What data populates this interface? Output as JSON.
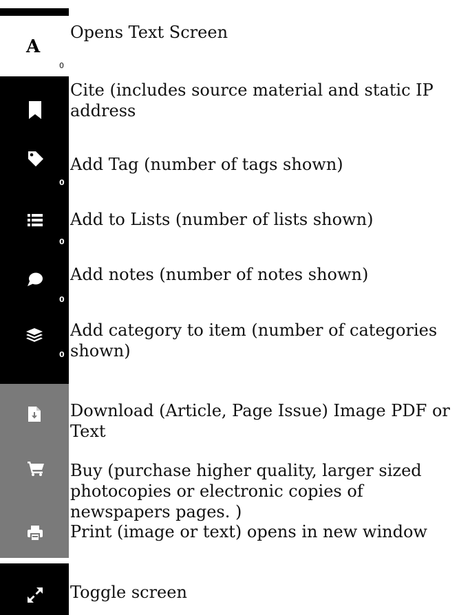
{
  "toolbar": {
    "text_button": {
      "letter": "A",
      "count": "0",
      "label": "Opens Text Screen"
    },
    "cite_button": {
      "label": "Cite (includes source material and static IP address"
    },
    "tag_button": {
      "count": "0",
      "label": "Add Tag (number of tags shown)"
    },
    "lists_button": {
      "count": "0",
      "label": "Add to Lists (number of lists shown)"
    },
    "notes_button": {
      "count": "0",
      "label": "Add notes (number of notes shown)"
    },
    "category_button": {
      "count": "0",
      "label": "Add category to item (number of categories shown)"
    },
    "download_button": {
      "label": "Download (Article, Page Issue) Image PDF or Text"
    },
    "buy_button": {
      "label": "Buy (purchase higher quality, larger sized photocopies or electronic copies of newspapers pages. )"
    },
    "print_button": {
      "label": "Print (image or text) opens in new window"
    },
    "toggle_button": {
      "label": "Toggle screen"
    }
  },
  "colors": {
    "sidebar_dark": "#000000",
    "sidebar_grey": "#7a7a7a",
    "icon": "#ffffff"
  },
  "icons": [
    "bookmark-icon",
    "tag-icon",
    "list-icon",
    "comment-icon",
    "layers-icon",
    "download-icon",
    "cart-icon",
    "print-icon",
    "expand-icon"
  ]
}
